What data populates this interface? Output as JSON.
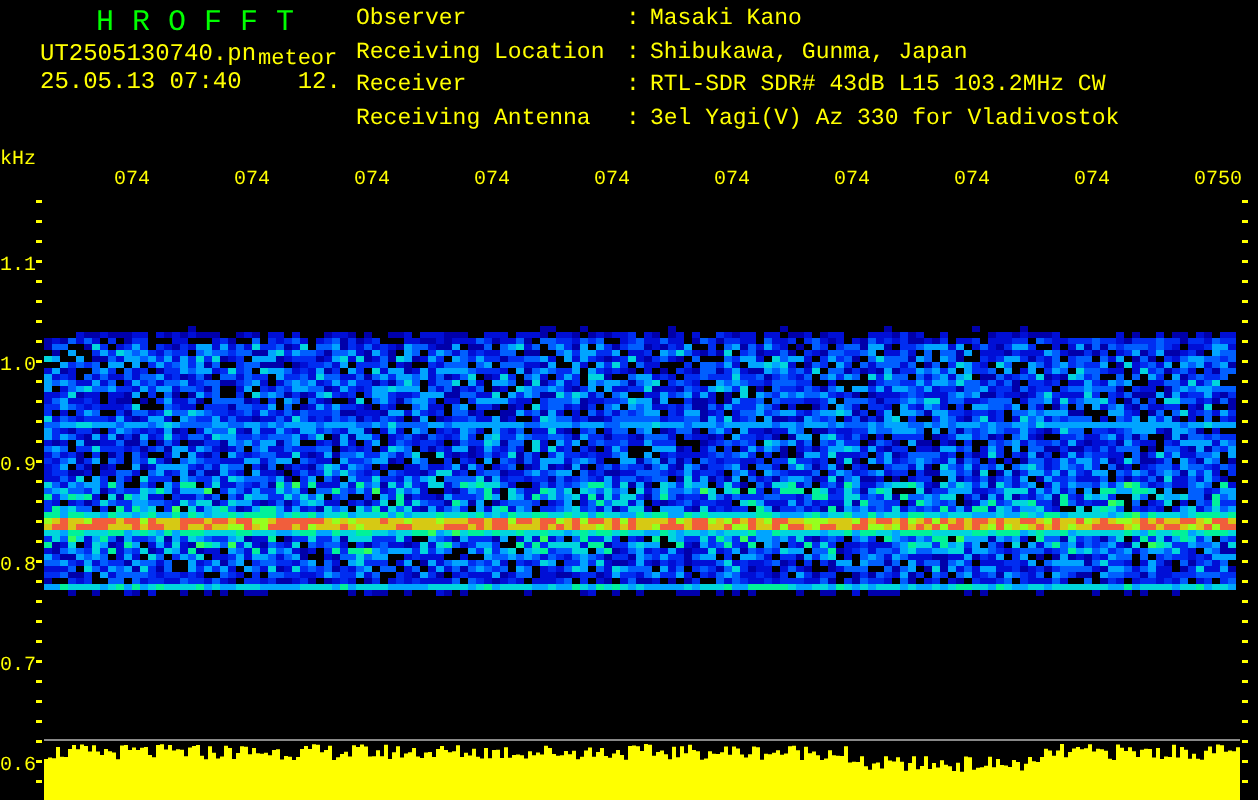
{
  "header": {
    "app_title": "H R O F F T",
    "file_name": "UT2505130740.pn",
    "mode": "meteor",
    "timestamp": "25.05.13 07:40",
    "count": "12.",
    "fields": [
      {
        "label": "Observer",
        "separator": ":",
        "value": "Masaki Kano"
      },
      {
        "label": "Receiving Location",
        "separator": ":",
        "value": "Shibukawa, Gunma, Japan"
      },
      {
        "label": "Receiver",
        "separator": ":",
        "value": "RTL-SDR SDR# 43dB L15 103.2MHz CW"
      },
      {
        "label": "Receiving Antenna",
        "separator": ":",
        "value": "3el Yagi(V) Az 330 for Vladivostok"
      }
    ]
  },
  "plot": {
    "y_unit": "kHz",
    "time_labels": [
      "074",
      "074",
      "074",
      "074",
      "074",
      "074",
      "074",
      "074",
      "074",
      "0750"
    ],
    "frequency_labels": [
      "1.1",
      "1.0",
      "0.9",
      "0.8",
      "0.7",
      "0.6"
    ]
  }
}
